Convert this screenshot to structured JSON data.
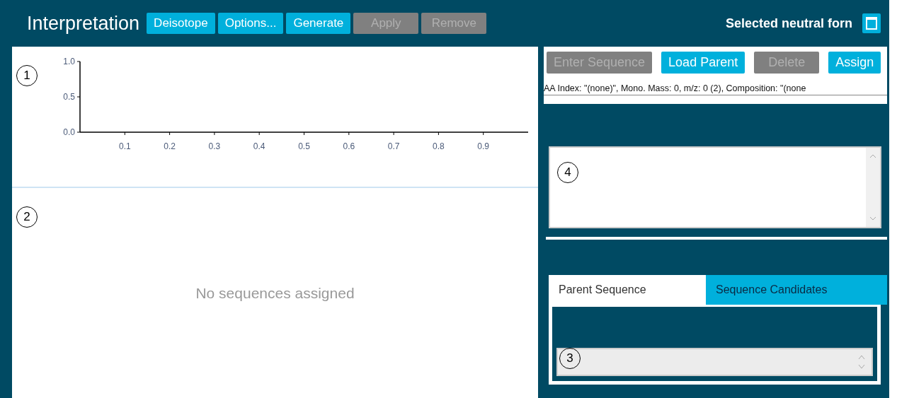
{
  "header": {
    "title": "Interpretation",
    "buttons": [
      {
        "label": "Deisotope",
        "disabled": false
      },
      {
        "label": "Options...",
        "disabled": false
      },
      {
        "label": "Generate",
        "disabled": false
      },
      {
        "label": "Apply",
        "disabled": true
      },
      {
        "label": "Remove",
        "disabled": true
      }
    ],
    "selected_label": "Selected neutral forn"
  },
  "spectrum": {
    "callout": "1",
    "chart_data": {
      "type": "line",
      "xlim": [
        0,
        1
      ],
      "ylim": [
        0,
        1
      ],
      "xticks": [
        0.1,
        0.2,
        0.3,
        0.4,
        0.5,
        0.6,
        0.7,
        0.8,
        0.9
      ],
      "yticks": [
        {
          "value": 0,
          "label": "0.0"
        },
        {
          "value": 0.5,
          "label": "0.5"
        },
        {
          "value": 1,
          "label": "1.0"
        }
      ]
    }
  },
  "sequences": {
    "callout": "2",
    "empty_text": "No sequences assigned"
  },
  "sequence_toolbar": {
    "buttons": [
      {
        "label": "Enter Sequence",
        "disabled": true
      },
      {
        "label": "Load Parent",
        "disabled": false
      },
      {
        "label": "Delete",
        "disabled": true
      },
      {
        "label": "Assign",
        "disabled": false
      }
    ],
    "info": "AA Index: \"(none)\", Mono. Mass: 0, m/z: 0 (2), Composition: \"(none"
  },
  "sequence_box": {
    "callout": "4"
  },
  "tabs": [
    {
      "label": "Parent Sequence",
      "selected": true
    },
    {
      "label": "Sequence Candidates",
      "selected": false
    }
  ],
  "parent_field": {
    "callout": "3"
  }
}
